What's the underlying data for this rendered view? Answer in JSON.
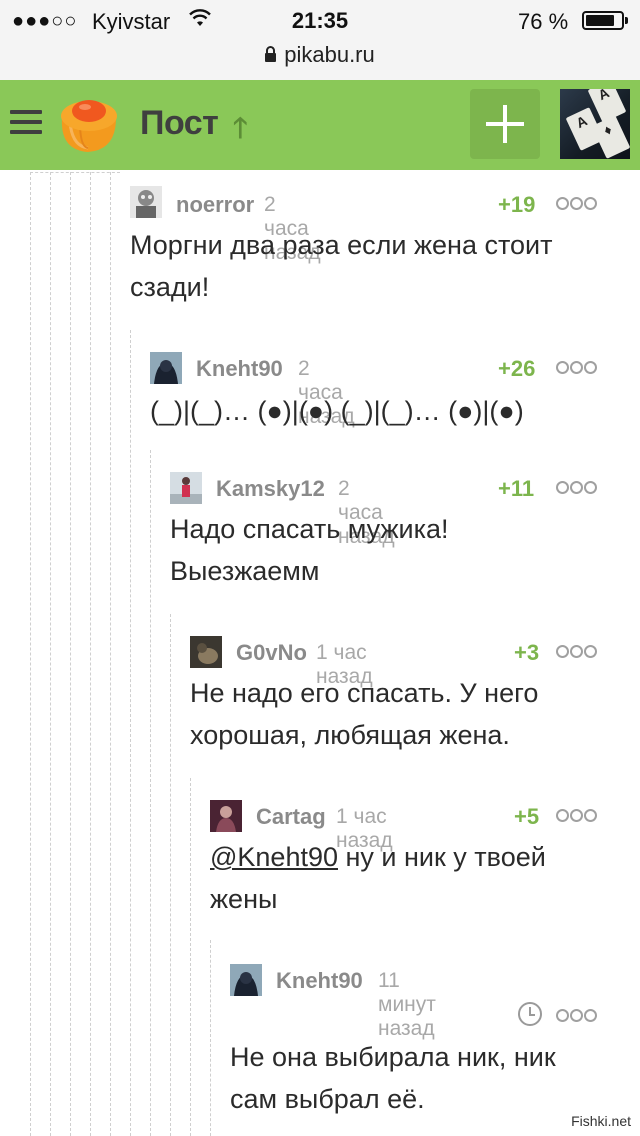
{
  "status_bar": {
    "signal": "●●●○○",
    "carrier": "Kyivstar",
    "time": "21:35",
    "battery": "76 %",
    "url": "pikabu.ru"
  },
  "header": {
    "title": "Пост",
    "bg_color": "#8ac858",
    "accent_color": "#7db54d"
  },
  "comments": [
    {
      "user": "noerror",
      "time": "2 часа назад",
      "rating": "+19",
      "text": "Моргни два раза если жена стоит сзади!"
    },
    {
      "user": "Kneht90",
      "time": "2 часа назад",
      "rating": "+26",
      "text": "(_)|(_)… (●)|(●) (_)|(_)… (●)|(●)"
    },
    {
      "user": "Kamsky12",
      "time": "2 часа назад",
      "rating": "+11",
      "text": "Надо спасать мужика! Выезжаемм"
    },
    {
      "user": "G0vNo",
      "time": "1 час назад",
      "rating": "+3",
      "text": "Не надо его спасать. У него хорошая, любящая жена."
    },
    {
      "user": "Cartag",
      "time": "1 час назад",
      "rating": "+5",
      "mention": "@Kneht90",
      "text": " ну и ник у твоей жены"
    },
    {
      "user": "Kneht90",
      "time": "11 минут назад",
      "text": "Не она выбирала ник, ник сам выбрал её."
    }
  ],
  "watermark": "Fishki.net"
}
